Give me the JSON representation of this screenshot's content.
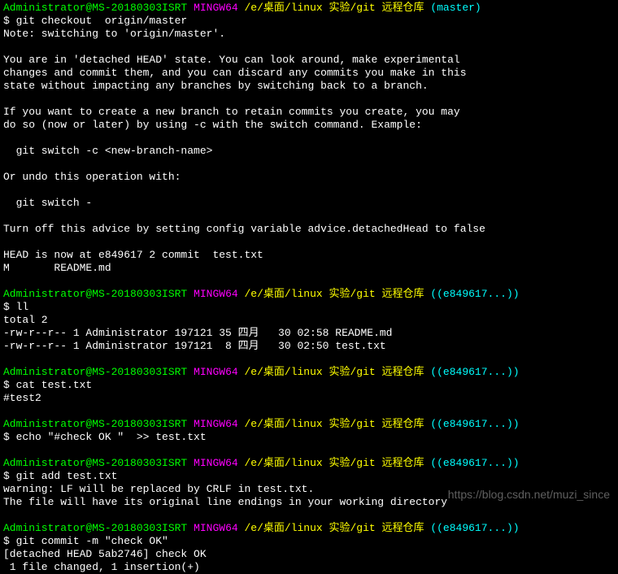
{
  "prompt": {
    "user": "Administrator@MS-20180303ISRT",
    "env": "MINGW64",
    "path": "/e/桌面/linux 实验/git 远程仓库",
    "branch_master": "(master)",
    "branch_detached": "((e849617...))"
  },
  "block1": {
    "cmd": "$ git checkout  origin/master",
    "note": "Note: switching to 'origin/master'.",
    "l1": "You are in 'detached HEAD' state. You can look around, make experimental",
    "l2": "changes and commit them, and you can discard any commits you make in this",
    "l3": "state without impacting any branches by switching back to a branch.",
    "l4": "If you want to create a new branch to retain commits you create, you may",
    "l5": "do so (now or later) by using -c with the switch command. Example:",
    "l6": "  git switch -c <new-branch-name>",
    "l7": "Or undo this operation with:",
    "l8": "  git switch -",
    "l9": "Turn off this advice by setting config variable advice.detachedHead to false",
    "l10": "HEAD is now at e849617 2 commit  test.txt",
    "l11": "M       README.md"
  },
  "block2": {
    "cmd": "$ ll",
    "l1": "total 2",
    "l2": "-rw-r--r-- 1 Administrator 197121 35 四月   30 02:58 README.md",
    "l3": "-rw-r--r-- 1 Administrator 197121  8 四月   30 02:50 test.txt"
  },
  "block3": {
    "cmd": "$ cat test.txt",
    "l1": "#test2"
  },
  "block4": {
    "cmd": "$ echo \"#check OK \"  >> test.txt"
  },
  "block5": {
    "cmd": "$ git add test.txt",
    "l1": "warning: LF will be replaced by CRLF in test.txt.",
    "l2": "The file will have its original line endings in your working directory"
  },
  "block6": {
    "cmd": "$ git commit -m \"check OK\"",
    "l1": "[detached HEAD 5ab2746] check OK",
    "l2": " 1 file changed, 1 insertion(+)"
  },
  "watermark": "https://blog.csdn.net/muzi_since"
}
